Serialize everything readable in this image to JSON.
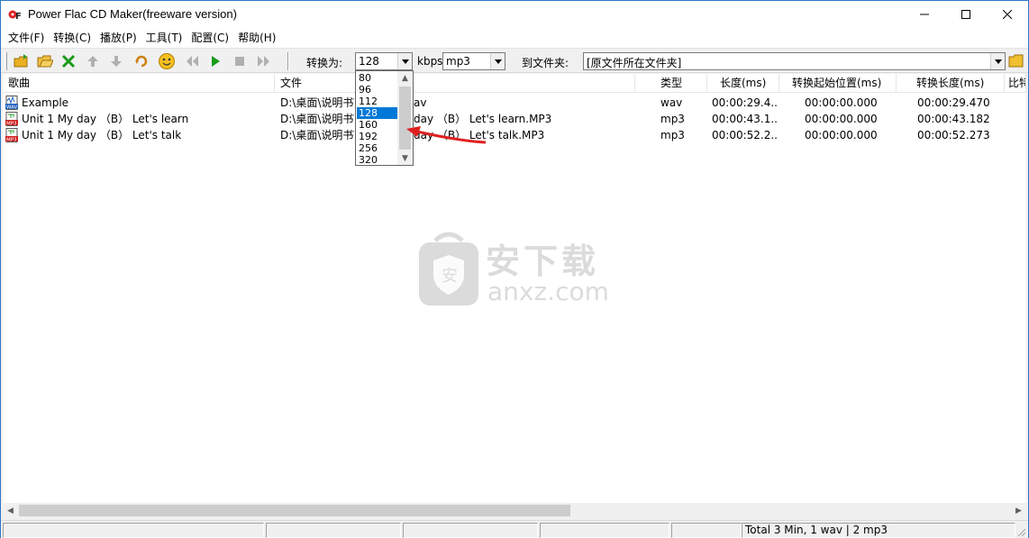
{
  "window": {
    "title": "Power Flac CD Maker(freeware version)"
  },
  "menu": [
    {
      "label": "文件(F)"
    },
    {
      "label": "转换(C)"
    },
    {
      "label": "播放(P)"
    },
    {
      "label": "工具(T)"
    },
    {
      "label": "配置(C)"
    },
    {
      "label": "帮助(H)"
    }
  ],
  "toolbar": {
    "convert_label": "转换为:",
    "bitrate_value": "128",
    "kbps_label": "kbps",
    "format_value": "mp3",
    "dest_label": "到文件夹:",
    "dest_value": "[原文件所在文件夹]"
  },
  "bitrate_options": [
    "80",
    "96",
    "112",
    "128",
    "160",
    "192",
    "256",
    "320"
  ],
  "bitrate_selected": "128",
  "columns": [
    "歌曲",
    "文件",
    "类型",
    "长度(ms)",
    "转换起始位置(ms)",
    "转换长度(ms)",
    "比特"
  ],
  "rows": [
    {
      "icon": "wav-file-icon",
      "song": "Example",
      "file": "D:\\桌面\\说明书\\",
      "file_tail": "av",
      "type": "wav",
      "length": "00:00:29.4...",
      "start": "00:00:00.000",
      "conv_length": "00:00:29.470"
    },
    {
      "icon": "mp3-file-icon",
      "song": "Unit 1 My day （B） Let's learn",
      "file": "D:\\桌面\\说明书\\",
      "file_tail": "day （B） Let's learn.MP3",
      "type": "mp3",
      "length": "00:00:43.1...",
      "start": "00:00:00.000",
      "conv_length": "00:00:43.182"
    },
    {
      "icon": "mp3-file-icon",
      "song": "Unit 1 My day （B） Let's talk",
      "file": "D:\\桌面\\说明书\\",
      "file_tail": "day （B） Let's talk.MP3",
      "type": "mp3",
      "length": "00:00:52.2...",
      "start": "00:00:00.000",
      "conv_length": "00:00:52.273"
    }
  ],
  "watermark": {
    "cn": "安下载",
    "en": "anxz.com"
  },
  "status": {
    "summary": "Total 3 Min, 1 wav | 2 mp3"
  },
  "colors": {
    "accent": "#0078d7",
    "arrow": "#e02020"
  }
}
